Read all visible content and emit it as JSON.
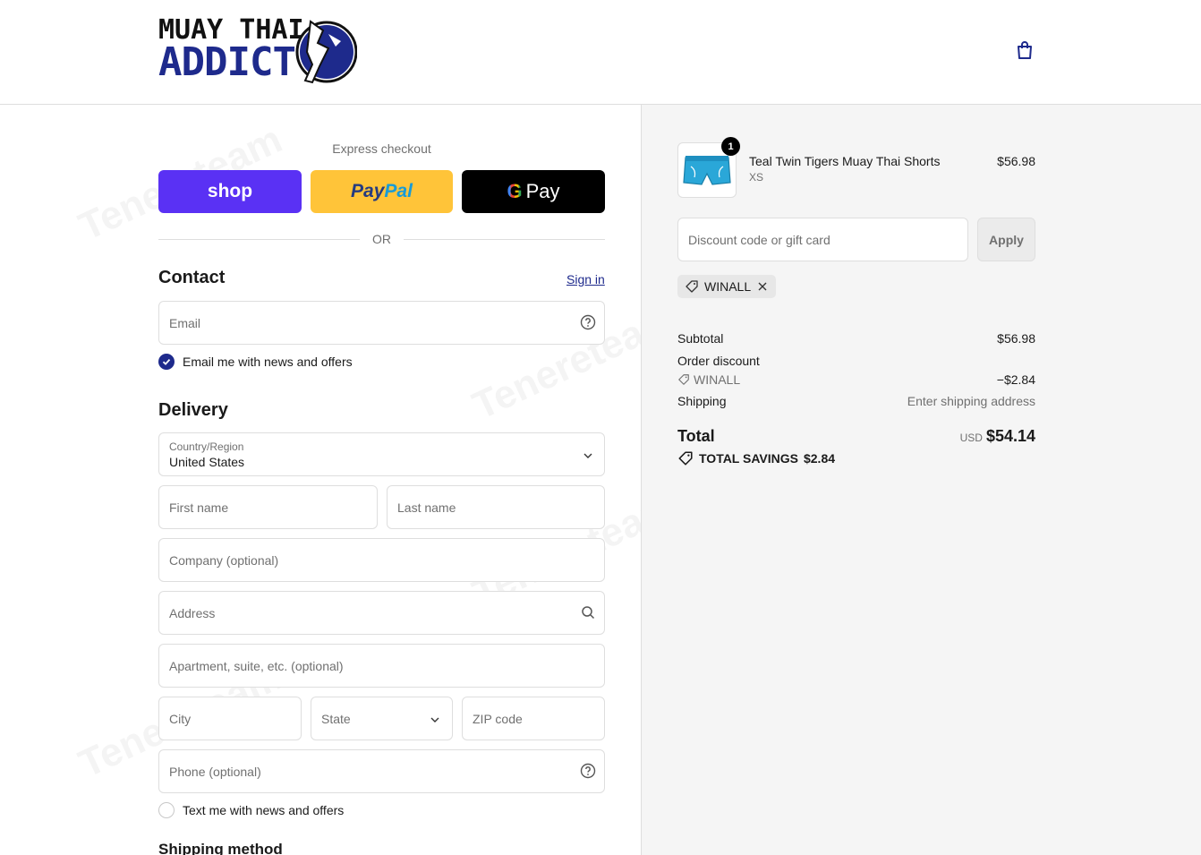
{
  "header": {
    "logo_line1": "MUAY THAI",
    "logo_line2": "ADDICT"
  },
  "express": {
    "label": "Express checkout",
    "shop_label": "shop",
    "paypal_part1": "Pay",
    "paypal_part2": "Pal",
    "gpay_g": "G",
    "gpay_label": "Pay"
  },
  "divider": {
    "label": "OR"
  },
  "contact": {
    "title": "Contact",
    "sign_in": "Sign in",
    "email_placeholder": "Email",
    "news_label": "Email me with news and offers"
  },
  "delivery": {
    "title": "Delivery",
    "country_label": "Country/Region",
    "country_value": "United States",
    "first_name": "First name",
    "last_name": "Last name",
    "company": "Company (optional)",
    "address": "Address",
    "apartment": "Apartment, suite, etc. (optional)",
    "city": "City",
    "state": "State",
    "zip": "ZIP code",
    "phone": "Phone (optional)",
    "text_offers": "Text me with news and offers"
  },
  "shipping": {
    "title": "Shipping method"
  },
  "order": {
    "quantity": "1",
    "product_name": "Teal Twin Tigers Muay Thai Shorts",
    "variant": "XS",
    "price": "$56.98",
    "discount_placeholder": "Discount code or gift card",
    "apply_label": "Apply",
    "code": "WINALL",
    "subtotal_label": "Subtotal",
    "subtotal_value": "$56.98",
    "order_discount_label": "Order discount",
    "discount_code": "WINALL",
    "discount_value": "−$2.84",
    "shipping_label": "Shipping",
    "shipping_value": "Enter shipping address",
    "total_label": "Total",
    "currency": "USD",
    "total_value": "$54.14",
    "savings_label": "TOTAL SAVINGS",
    "savings_value": "$2.84"
  },
  "watermark": "Tenereteam",
  "colors": {
    "brand": "#1e2a8c",
    "shop": "#5a31f4",
    "paypal": "#ffc439",
    "gpay": "#000000"
  }
}
